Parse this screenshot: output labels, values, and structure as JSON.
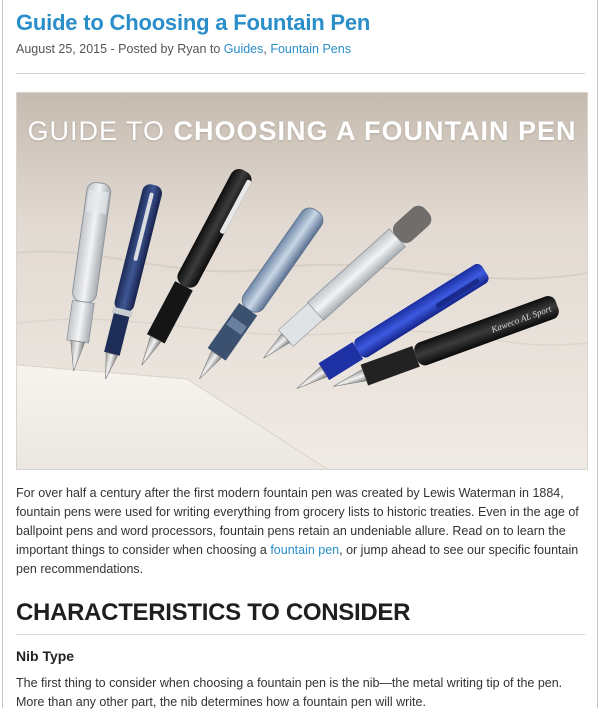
{
  "post": {
    "title": "Guide to Choosing a Fountain Pen",
    "meta": {
      "prefix": "August 25, 2015 - Posted by Ryan to ",
      "category1": "Guides",
      "sep": ", ",
      "category2": "Fountain Pens"
    }
  },
  "hero": {
    "title_part1": "GUIDE TO ",
    "title_part2": "CHOOSING A FOUNTAIN PEN",
    "pen_imprint": "Kaweco AL Sport"
  },
  "intro": {
    "text_before_link": "For over half a century after the first modern fountain pen was created by Lewis Waterman in 1884, fountain pens were used for writing everything from grocery lists to historic treaties. Even in the age of ballpoint pens and word processors, fountain pens retain an undeniable allure. Read on to learn the important things to consider when choosing a ",
    "link_text": "fountain pen",
    "text_after_link": ", or jump ahead to see our specific fountain pen recommendations."
  },
  "section": {
    "heading": "CHARACTERISTICS TO CONSIDER",
    "subheading": "Nib Type",
    "paragraph": "The first thing to consider when choosing a fountain pen is the nib—the metal writing tip of the pen. More than any other part, the nib determines how a fountain pen will write."
  },
  "colors": {
    "link": "#2a8ec9",
    "heading": "#1f1f1f",
    "body_text": "#333333"
  }
}
